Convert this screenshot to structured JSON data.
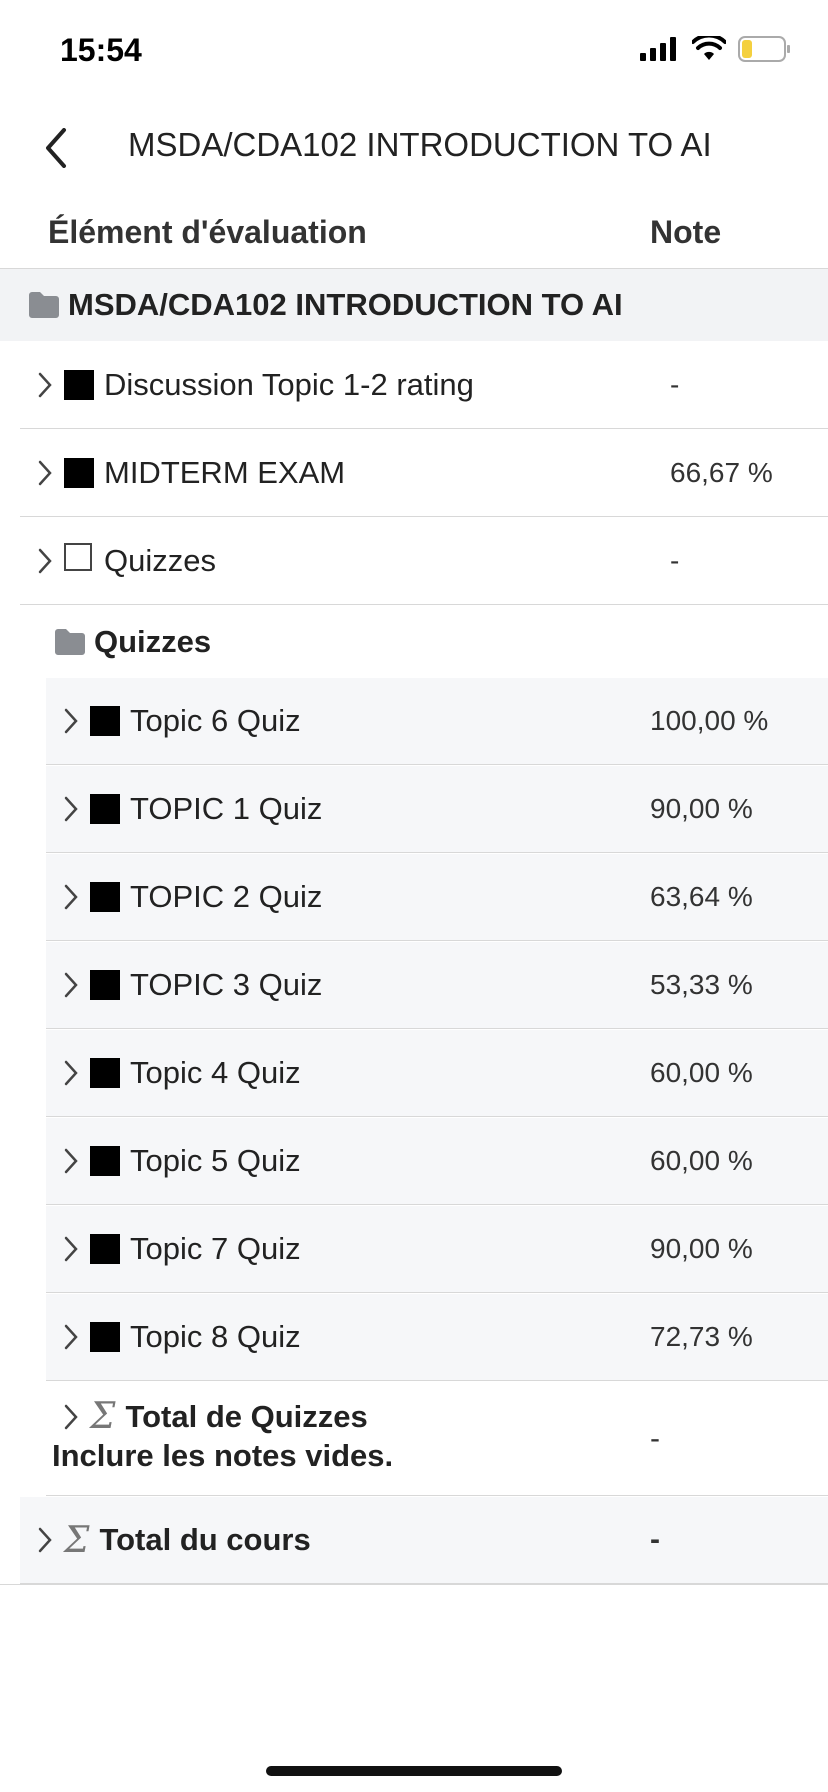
{
  "status_bar": {
    "time": "15:54"
  },
  "header": {
    "title": "MSDA/CDA102 INTRODUCTION TO AI"
  },
  "columns": {
    "item": "Élément d'évaluation",
    "grade": "Note"
  },
  "course_category": "MSDA/CDA102 INTRODUCTION TO AI",
  "top_items": [
    {
      "label": "Discussion Topic 1-2 rating",
      "grade": "-"
    },
    {
      "label": "MIDTERM EXAM",
      "grade": "66,67 %"
    },
    {
      "label": "Quizzes",
      "grade": "-"
    }
  ],
  "quizzes_category": "Quizzes",
  "quiz_items": [
    {
      "label": "Topic 6 Quiz",
      "grade": "100,00 %"
    },
    {
      "label": "TOPIC 1 Quiz",
      "grade": "90,00 %"
    },
    {
      "label": "TOPIC 2 Quiz",
      "grade": "63,64 %"
    },
    {
      "label": "TOPIC 3 Quiz",
      "grade": "53,33 %"
    },
    {
      "label": "Topic 4 Quiz",
      "grade": "60,00 %"
    },
    {
      "label": "Topic 5 Quiz",
      "grade": "60,00 %"
    },
    {
      "label": "Topic 7 Quiz",
      "grade": "90,00 %"
    },
    {
      "label": "Topic 8 Quiz",
      "grade": "72,73 %"
    }
  ],
  "quizzes_total": {
    "label": "Total de Quizzes",
    "note": "Inclure les notes vides.",
    "grade": "-"
  },
  "course_total": {
    "label": "Total du cours",
    "grade": "-"
  }
}
